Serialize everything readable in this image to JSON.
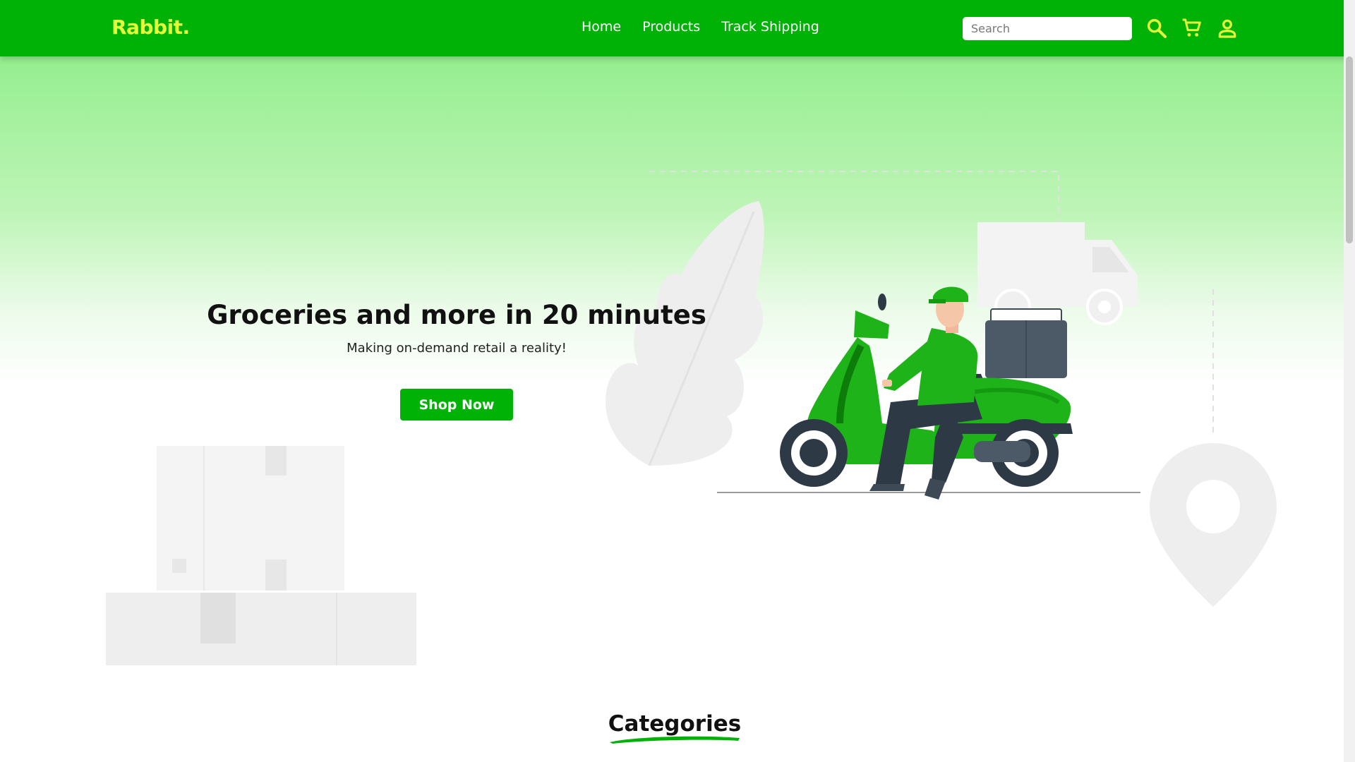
{
  "brand": {
    "logo": "Rabbit."
  },
  "nav": {
    "links": [
      {
        "label": "Home"
      },
      {
        "label": "Products"
      },
      {
        "label": "Track Shipping"
      }
    ],
    "search": {
      "placeholder": "Search",
      "value": ""
    },
    "icons": [
      "search-icon",
      "cart-icon",
      "user-icon"
    ]
  },
  "hero": {
    "title": "Groceries and more in 20 minutes",
    "subtitle": "Making on-demand retail a reality!",
    "cta_label": "Shop Now"
  },
  "sections": {
    "categories_title": "Categories"
  },
  "colors": {
    "primary": "#00b206",
    "logo": "#e4ff3a",
    "hero_gradient_top": "#95ee8f",
    "text_dark": "#111111"
  }
}
